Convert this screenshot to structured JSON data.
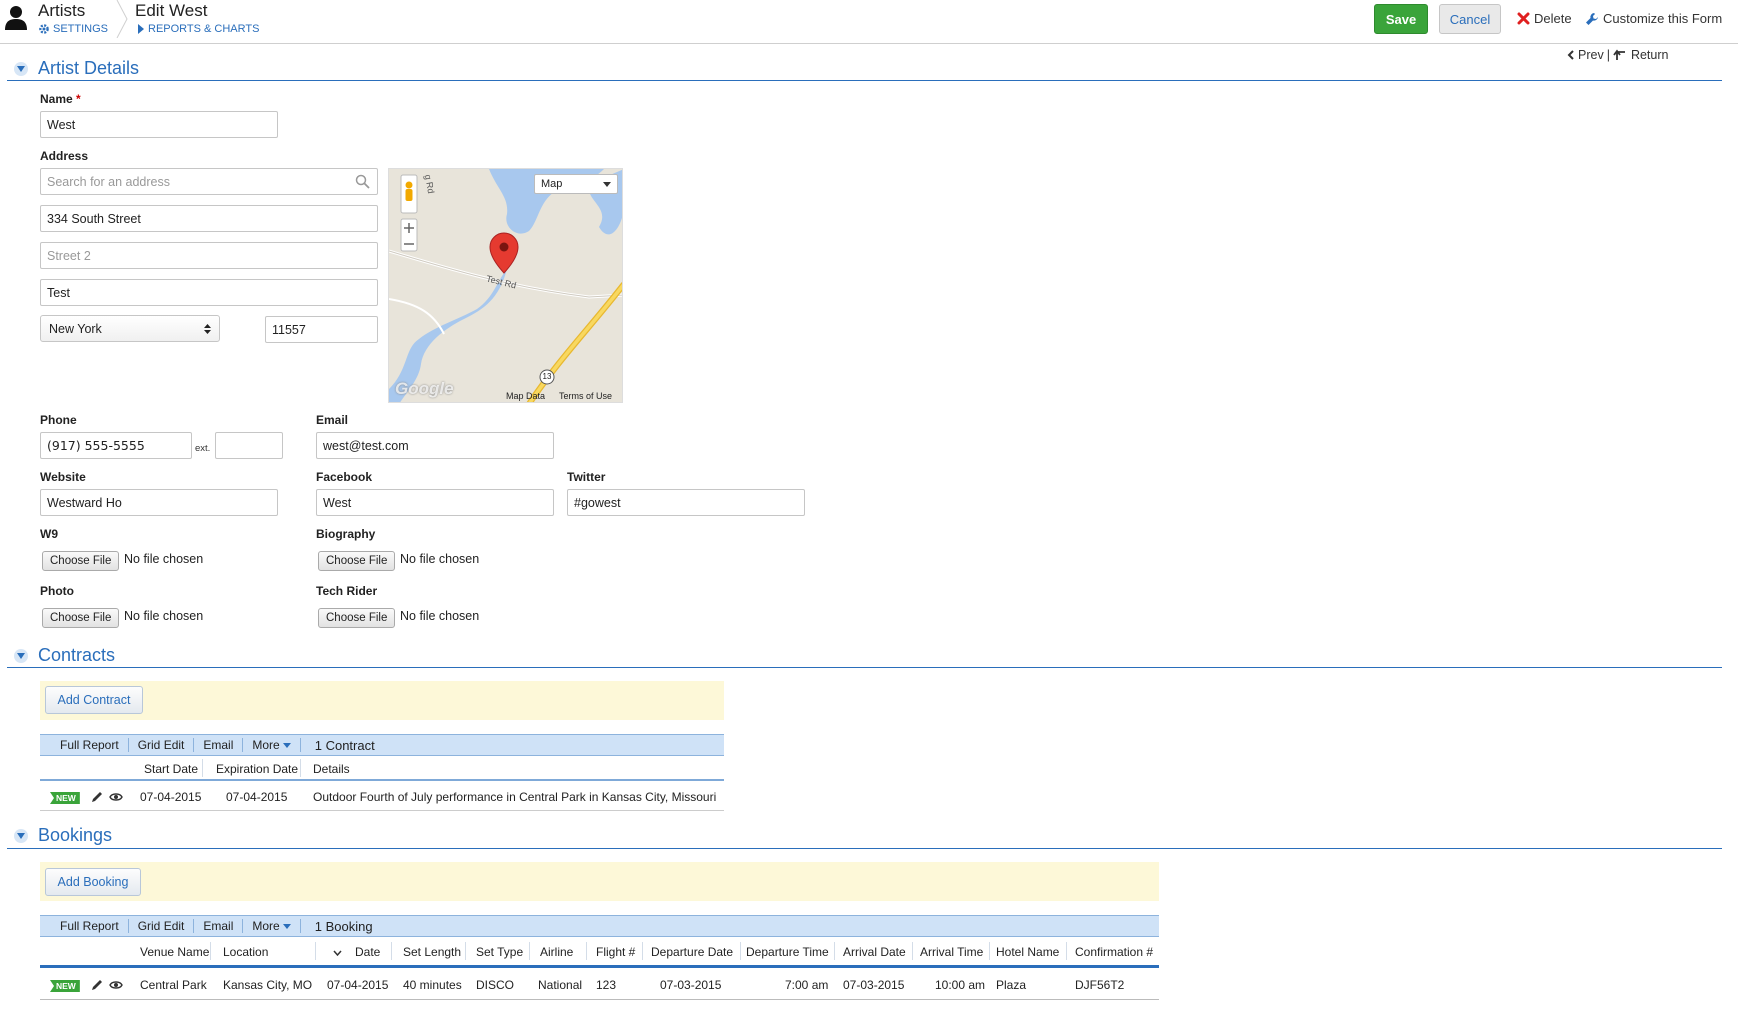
{
  "header": {
    "crumbs": [
      {
        "title": "Artists",
        "sub": "SETTINGS",
        "sub_icon": "gear-icon"
      },
      {
        "title": "Edit West",
        "sub": "REPORTS & CHARTS",
        "sub_icon": "play-icon"
      }
    ],
    "save_label": "Save",
    "cancel_label": "Cancel",
    "delete_label": "Delete",
    "customize_label": "Customize this Form",
    "prev_label": "Prev",
    "pipe": "|",
    "return_label": "Return"
  },
  "artist_details": {
    "title": "Artist Details",
    "name_label": "Name",
    "required_mark": "*",
    "name_value": "West",
    "address_label": "Address",
    "search_placeholder": "Search for an address",
    "street1": "334 South Street",
    "street2_placeholder": "Street 2",
    "city": "Test",
    "state": "New York",
    "zip": "11557",
    "map": {
      "type_label": "Map",
      "road_label_1": "Test Rd",
      "road_label_2": "g Rd",
      "route_number": "13",
      "attribution": "Map Data",
      "terms": "Terms of Use",
      "logo": "Google"
    },
    "phone_label": "Phone",
    "phone_value": "(917) 555-5555",
    "ext_label": "ext.",
    "ext_value": "",
    "email_label": "Email",
    "email_value": "west@test.com",
    "website_label": "Website",
    "website_value": "Westward Ho",
    "facebook_label": "Facebook",
    "facebook_value": "West",
    "twitter_label": "Twitter",
    "twitter_value": "#gowest",
    "files": [
      {
        "label": "W9",
        "button": "Choose File",
        "status": "No file chosen"
      },
      {
        "label": "Biography",
        "button": "Choose File",
        "status": "No file chosen"
      },
      {
        "label": "Photo",
        "button": "Choose File",
        "status": "No file chosen"
      },
      {
        "label": "Tech Rider",
        "button": "Choose File",
        "status": "No file chosen"
      }
    ]
  },
  "contracts": {
    "title": "Contracts",
    "add_label": "Add  Contract",
    "toolbar": [
      "Full Report",
      "Grid Edit",
      "Email",
      "More"
    ],
    "count": "1 Contract",
    "columns": [
      "Start Date",
      "Expiration Date",
      "Details"
    ],
    "rows": [
      {
        "badge": "NEW",
        "cells": [
          "07-04-2015",
          "07-04-2015",
          "Outdoor Fourth of July performance in Central Park in Kansas City, Missouri"
        ]
      }
    ]
  },
  "bookings": {
    "title": "Bookings",
    "add_label": "Add  Booking",
    "toolbar": [
      "Full Report",
      "Grid Edit",
      "Email",
      "More"
    ],
    "count": "1 Booking",
    "columns": [
      "Venue Name",
      "Location",
      "Date",
      "Set Length",
      "Set Type",
      "Airline",
      "Flight #",
      "Departure Date",
      "Departure Time",
      "Arrival Date",
      "Arrival Time",
      "Hotel Name",
      "Confirmation #"
    ],
    "rows": [
      {
        "badge": "NEW",
        "cells": [
          "Central Park",
          "Kansas City, MO",
          "07-04-2015",
          "40 minutes",
          "DISCO",
          "National",
          "123",
          "07-03-2015",
          "7:00 am",
          "07-03-2015",
          "10:00 am",
          "Plaza",
          "DJF56T2"
        ]
      }
    ]
  },
  "colors": {
    "accent": "#2a6ebb",
    "save": "#3aa43a",
    "toolbar": "#cfe2f7",
    "addbar": "#fdf8d8"
  }
}
